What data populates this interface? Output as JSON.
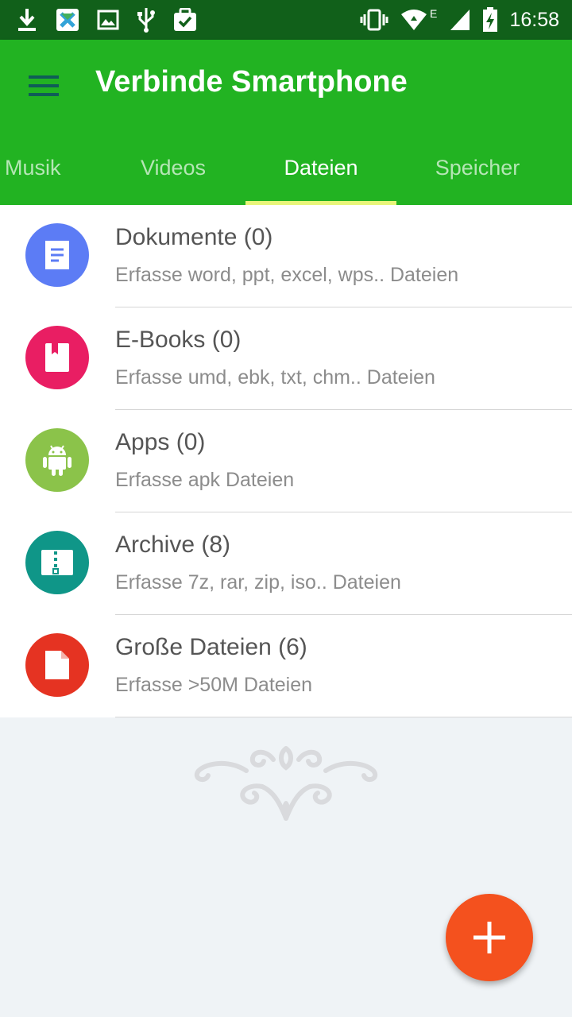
{
  "status_bar": {
    "time": "16:58",
    "network_type": "E",
    "icons_left": [
      "download-icon",
      "app-notification-icon",
      "image-icon",
      "usb-icon",
      "task-icon"
    ],
    "icons_right": [
      "vibrate-icon",
      "wifi-icon",
      "signal-icon",
      "battery-icon"
    ]
  },
  "app_bar": {
    "title": "Verbinde Smartphone",
    "menu_icon": "hamburger-menu-icon"
  },
  "tabs": [
    {
      "label": "Musik",
      "active": false
    },
    {
      "label": "Videos",
      "active": false
    },
    {
      "label": "Dateien",
      "active": true
    },
    {
      "label": "Speicher",
      "active": false
    }
  ],
  "categories": [
    {
      "title": "Dokumente (0)",
      "subtitle": "Erfasse word, ppt, excel, wps.. Dateien",
      "icon": "document-icon",
      "color": "#5c7cf5"
    },
    {
      "title": "E-Books (0)",
      "subtitle": "Erfasse umd, ebk, txt, chm.. Dateien",
      "icon": "book-icon",
      "color": "#e91e63"
    },
    {
      "title": "Apps (0)",
      "subtitle": "Erfasse apk Dateien",
      "icon": "android-icon",
      "color": "#8bc34a"
    },
    {
      "title": "Archive (8)",
      "subtitle": "Erfasse 7z, rar, zip, iso.. Dateien",
      "icon": "archive-icon",
      "color": "#0f9688"
    },
    {
      "title": "Große Dateien (6)",
      "subtitle": "Erfasse >50M Dateien",
      "icon": "file-icon",
      "color": "#e53322"
    }
  ],
  "fab": {
    "icon": "plus-icon",
    "color": "#f4511e"
  },
  "colors": {
    "app_bar": "#22b322",
    "status_bar": "#11601a",
    "tab_indicator": "#e8f57a"
  }
}
